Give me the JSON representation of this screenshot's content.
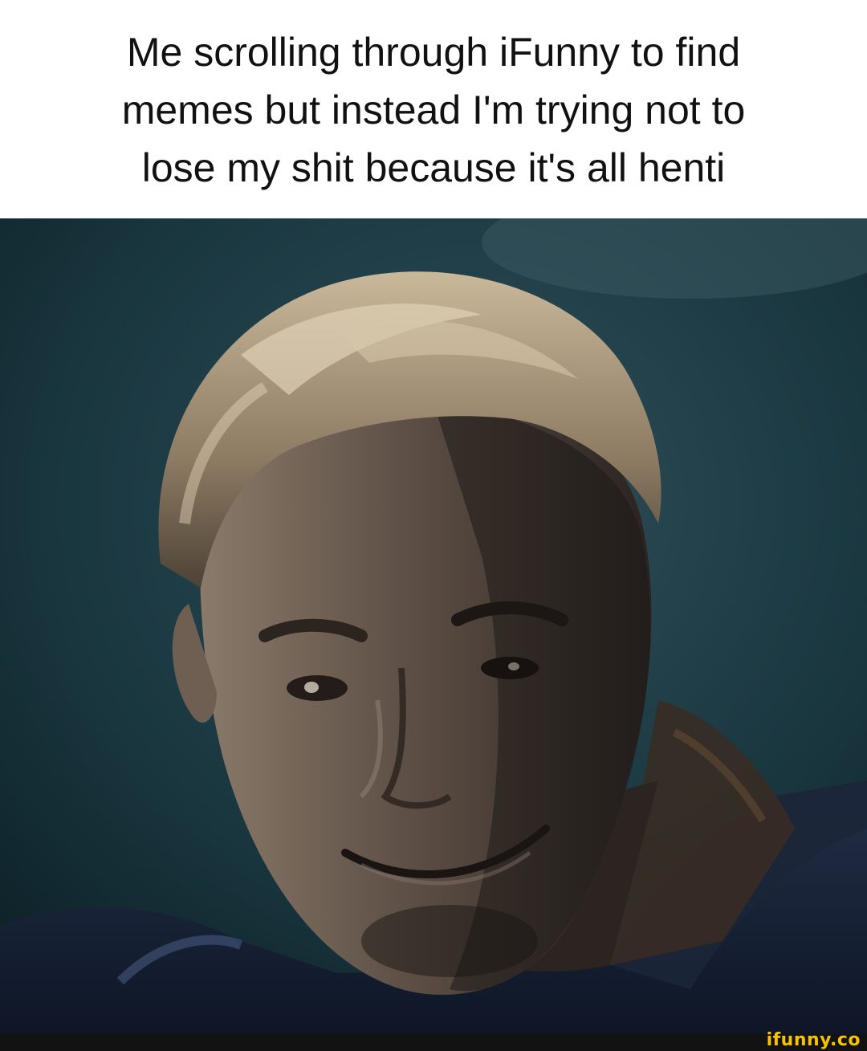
{
  "caption": {
    "lines": [
      "Me scrolling through iFunny to find",
      "memes but instead I'm trying not to",
      "lose my shit because it's all henti"
    ]
  },
  "photo": {
    "subject": "man-smirking"
  },
  "watermark": {
    "text": "ifunny.co",
    "color": "#f5c400"
  }
}
